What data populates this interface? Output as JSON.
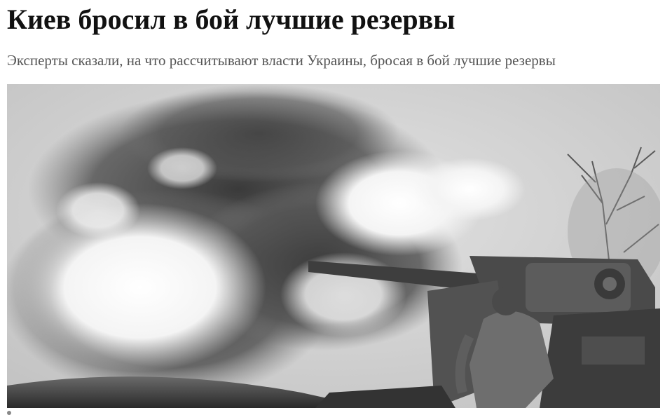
{
  "article": {
    "headline": "Киев бросил в бой лучшие резервы",
    "lead": "Эксперты сказали, на что рассчитывают власти Украины, бросая в бой лучшие резервы"
  },
  "photo": {
    "subject": "artillery-gun-firing",
    "tone": "grayscale"
  }
}
